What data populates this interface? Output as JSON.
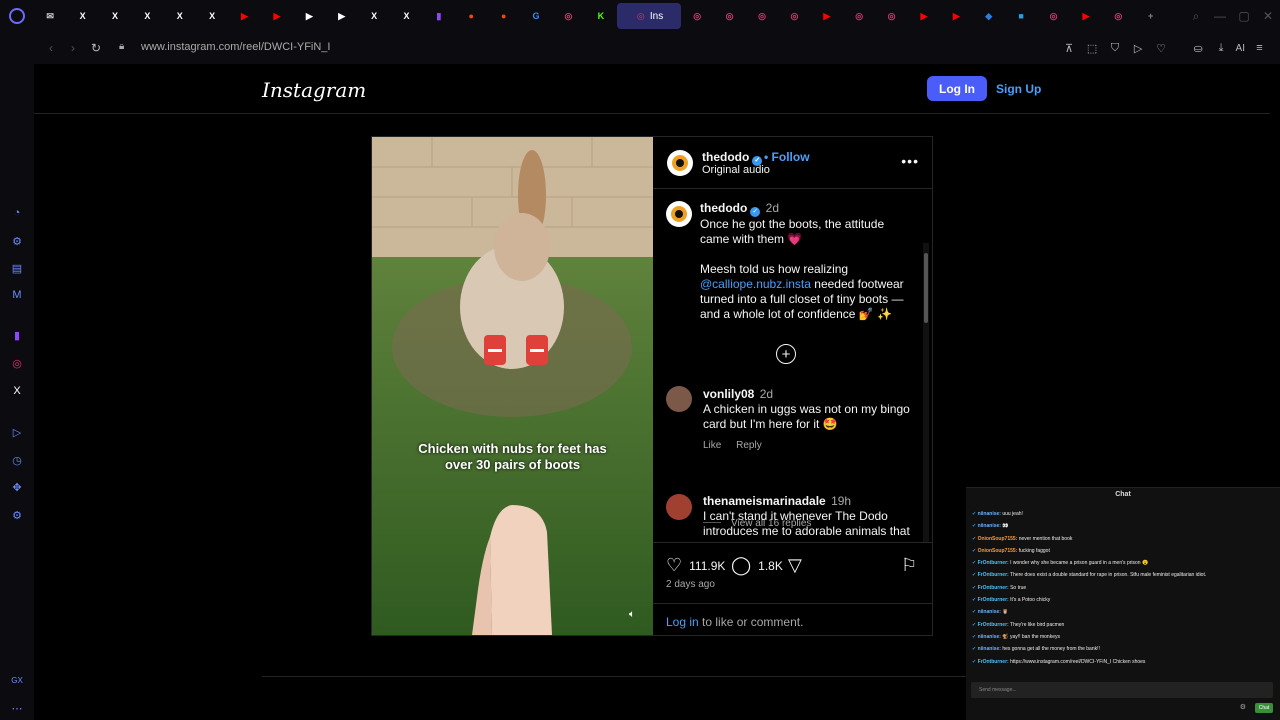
{
  "browser": {
    "tabs": [
      {
        "icon": "mail-icon",
        "glyph": "✉",
        "color": "#cccccc"
      },
      {
        "icon": "x-icon",
        "glyph": "X",
        "color": "#ffffff"
      },
      {
        "icon": "x-icon",
        "glyph": "X",
        "color": "#ffffff"
      },
      {
        "icon": "x-icon",
        "glyph": "X",
        "color": "#ffffff"
      },
      {
        "icon": "x-icon",
        "glyph": "X",
        "color": "#ffffff"
      },
      {
        "icon": "x-icon",
        "glyph": "X",
        "color": "#ffffff"
      },
      {
        "icon": "youtube-icon",
        "glyph": "▶",
        "color": "#ff0000"
      },
      {
        "icon": "youtube-icon",
        "glyph": "▶",
        "color": "#ff0000"
      },
      {
        "icon": "play-icon",
        "glyph": "▶",
        "color": "#ffffff"
      },
      {
        "icon": "play-icon",
        "glyph": "▶",
        "color": "#ffffff"
      },
      {
        "icon": "x-icon",
        "glyph": "X",
        "color": "#ffffff"
      },
      {
        "icon": "x-icon",
        "glyph": "X",
        "color": "#ffffff"
      },
      {
        "icon": "twitch-icon",
        "glyph": "▮",
        "color": "#9146ff"
      },
      {
        "icon": "reddit-icon",
        "glyph": "●",
        "color": "#ff4500"
      },
      {
        "icon": "reddit-icon",
        "glyph": "●",
        "color": "#ff4500"
      },
      {
        "icon": "google-icon",
        "glyph": "G",
        "color": "#4285f4"
      },
      {
        "icon": "instagram-icon",
        "glyph": "◎",
        "color": "#e1306c"
      },
      {
        "icon": "kick-icon",
        "glyph": "K",
        "color": "#53fc18"
      },
      {
        "icon": "instagram-icon",
        "glyph": "◎",
        "color": "#e1306c",
        "active": true,
        "label": "Ins"
      },
      {
        "icon": "instagram-icon",
        "glyph": "◎",
        "color": "#e1306c"
      },
      {
        "icon": "instagram-icon",
        "glyph": "◎",
        "color": "#e1306c"
      },
      {
        "icon": "instagram-icon",
        "glyph": "◎",
        "color": "#e1306c"
      },
      {
        "icon": "instagram-icon",
        "glyph": "◎",
        "color": "#e1306c"
      },
      {
        "icon": "youtube-icon",
        "glyph": "▶",
        "color": "#ff0000"
      },
      {
        "icon": "instagram-icon",
        "glyph": "◎",
        "color": "#e1306c"
      },
      {
        "icon": "instagram-icon",
        "glyph": "◎",
        "color": "#e1306c"
      },
      {
        "icon": "youtube-icon",
        "glyph": "▶",
        "color": "#ff0000"
      },
      {
        "icon": "youtube-icon",
        "glyph": "▶",
        "color": "#ff0000"
      },
      {
        "icon": "edge-icon",
        "glyph": "◆",
        "color": "#2a7de1"
      },
      {
        "icon": "app-icon",
        "glyph": "■",
        "color": "#2a9de1"
      },
      {
        "icon": "instagram-icon",
        "glyph": "◎",
        "color": "#e1306c"
      },
      {
        "icon": "youtube-icon",
        "glyph": "▶",
        "color": "#ff0000"
      },
      {
        "icon": "instagram-icon",
        "glyph": "◎",
        "color": "#e1306c"
      },
      {
        "icon": "new-tab-icon",
        "glyph": "+",
        "color": "#888888"
      }
    ],
    "url": "www.instagram.com/reel/DWCI-YFiN_I",
    "toolbar_ai": "AI"
  },
  "page": {
    "logo": "Instagram",
    "login_label": "Log In",
    "signup_label": "Sign Up"
  },
  "post": {
    "video_caption": "Chicken with nubs for feet has over 30 pairs of boots",
    "username": "thedodo",
    "follow": "• Follow",
    "audio": "Original audio",
    "caption": {
      "username": "thedodo",
      "time": "2d",
      "line1": "Once he got the boots, the attitude came with them 💗",
      "line2_pre": "Meesh told us how realizing",
      "mention": "@calliope.nubz.insta",
      "line2_post": "needed footwear turned into a full closet of tiny boots — and a whole lot of confidence 💅 ✨"
    },
    "comments": [
      {
        "username": "vonlily08",
        "time": "2d",
        "text": "A chicken in uggs was not on my bingo card but I'm here for it 🤩",
        "like": "Like",
        "reply": "Reply",
        "view_all": "View all 16 replies"
      },
      {
        "username": "thenameismarinadale",
        "time": "19h",
        "text": "I can't stand it whenever The Dodo introduces me to adorable animals that"
      }
    ],
    "likes": "111.9K",
    "comment_count": "1.8K",
    "posted": "2 days ago",
    "login_prompt_link": "Log in",
    "login_prompt_rest": " to like or comment."
  },
  "chat": {
    "title": "Chat",
    "messages": [
      {
        "user": "niinanise:",
        "color": "#6ab0ff",
        "text": "uuu jeah!"
      },
      {
        "user": "niinanise:",
        "color": "#6ab0ff",
        "text": "👀"
      },
      {
        "user": "OnionSoup7155:",
        "color": "#ff9a3c",
        "text": "never mention that book"
      },
      {
        "user": "OnionSoup7155:",
        "color": "#ff9a3c",
        "text": "fucking faggot"
      },
      {
        "user": "FrOntburner:",
        "color": "#4fc3f7",
        "text": "I wonder why she became a prison guard in a men's prison 😮"
      },
      {
        "user": "FrOntburner:",
        "color": "#4fc3f7",
        "text": "There does exist a double standard for rape in prison. Stfu male feminist egalitarian idiot."
      },
      {
        "user": "FrOntburner:",
        "color": "#4fc3f7",
        "text": "So true"
      },
      {
        "user": "FrOntburner:",
        "color": "#4fc3f7",
        "text": "It's a Potoo chicky"
      },
      {
        "user": "niinanise:",
        "color": "#6ab0ff",
        "text": "🦉"
      },
      {
        "user": "FrOntburner:",
        "color": "#4fc3f7",
        "text": "They're like bird pacmen"
      },
      {
        "user": "niinanise:",
        "color": "#6ab0ff",
        "text": "🐒 yay!! ban the monkeys"
      },
      {
        "user": "niinanise:",
        "color": "#6ab0ff",
        "text": "hes gonna get all the money from the bank!!"
      },
      {
        "user": "FrOntburner:",
        "color": "#4fc3f7",
        "text": "https://www.instagram.com/reel/DWCI-YFiN_I  Chicken shoes"
      }
    ],
    "placeholder": "Send message...",
    "send_label": "Chat"
  }
}
